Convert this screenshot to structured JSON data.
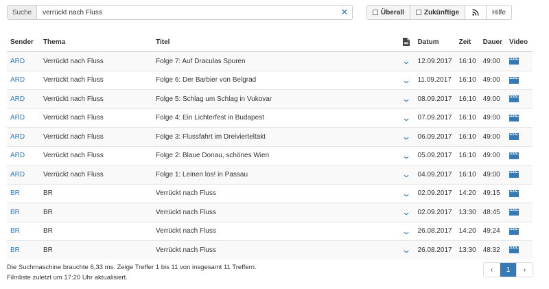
{
  "search": {
    "label": "Suche",
    "value": "verrückt nach Fluss",
    "clear_icon": "close-icon"
  },
  "toolbar": {
    "overall_label": "Überall",
    "future_label": "Zukünftige",
    "rss_icon": "rss-icon",
    "help_label": "Hilfe"
  },
  "table": {
    "headers": {
      "sender": "Sender",
      "thema": "Thema",
      "titel": "Titel",
      "desc_icon": "document-icon",
      "datum": "Datum",
      "zeit": "Zeit",
      "dauer": "Dauer",
      "video": "Video"
    },
    "rows": [
      {
        "sender": "ARD",
        "thema": "Verrückt nach Fluss",
        "titel": "Folge 7: Auf Draculas Spuren",
        "datum": "12.09.2017",
        "zeit": "16:10",
        "dauer": "49:00"
      },
      {
        "sender": "ARD",
        "thema": "Verrückt nach Fluss",
        "titel": "Folge 6: Der Barbier von Belgrad",
        "datum": "11.09.2017",
        "zeit": "16:10",
        "dauer": "49:00"
      },
      {
        "sender": "ARD",
        "thema": "Verrückt nach Fluss",
        "titel": "Folge 5: Schlag um Schlag in Vukovar",
        "datum": "08.09.2017",
        "zeit": "16:10",
        "dauer": "49:00"
      },
      {
        "sender": "ARD",
        "thema": "Verrückt nach Fluss",
        "titel": "Folge 4: Ein Lichterfest in Budapest",
        "datum": "07.09.2017",
        "zeit": "16:10",
        "dauer": "49:00"
      },
      {
        "sender": "ARD",
        "thema": "Verrückt nach Fluss",
        "titel": "Folge 3: Flussfahrt im Dreivierteltakt",
        "datum": "06.09.2017",
        "zeit": "16:10",
        "dauer": "49:00"
      },
      {
        "sender": "ARD",
        "thema": "Verrückt nach Fluss",
        "titel": "Folge 2: Blaue Donau, schönes Wien",
        "datum": "05.09.2017",
        "zeit": "16:10",
        "dauer": "49:00"
      },
      {
        "sender": "ARD",
        "thema": "Verrückt nach Fluss",
        "titel": "Folge 1: Leinen los! in Passau",
        "datum": "04.09.2017",
        "zeit": "16:10",
        "dauer": "49:00"
      },
      {
        "sender": "BR",
        "thema": "BR",
        "titel": "Verrückt nach Fluss",
        "datum": "02.09.2017",
        "zeit": "14:20",
        "dauer": "49:15"
      },
      {
        "sender": "BR",
        "thema": "BR",
        "titel": "Verrückt nach Fluss",
        "datum": "02.09.2017",
        "zeit": "13:30",
        "dauer": "48:45"
      },
      {
        "sender": "BR",
        "thema": "BR",
        "titel": "Verrückt nach Fluss",
        "datum": "26.08.2017",
        "zeit": "14:20",
        "dauer": "49:24"
      },
      {
        "sender": "BR",
        "thema": "BR",
        "titel": "Verrückt nach Fluss",
        "datum": "26.08.2017",
        "zeit": "13:30",
        "dauer": "48:32"
      }
    ],
    "expand_icon": "chevron-down-icon",
    "video_icon": "clapperboard-icon"
  },
  "footer": {
    "stats_line": "Die Suchmaschine brauchte 6,33 ms. Zeige Treffer 1 bis 11 von insgesamt 11 Treffern.",
    "updated_line": "Filmliste zuletzt um 17:20 Uhr aktualisiert."
  },
  "pagination": {
    "prev_label": "‹",
    "current_page": "1",
    "next_label": "›"
  },
  "colors": {
    "accent": "#337ab7",
    "row_stripe": "#f9f9f9"
  }
}
